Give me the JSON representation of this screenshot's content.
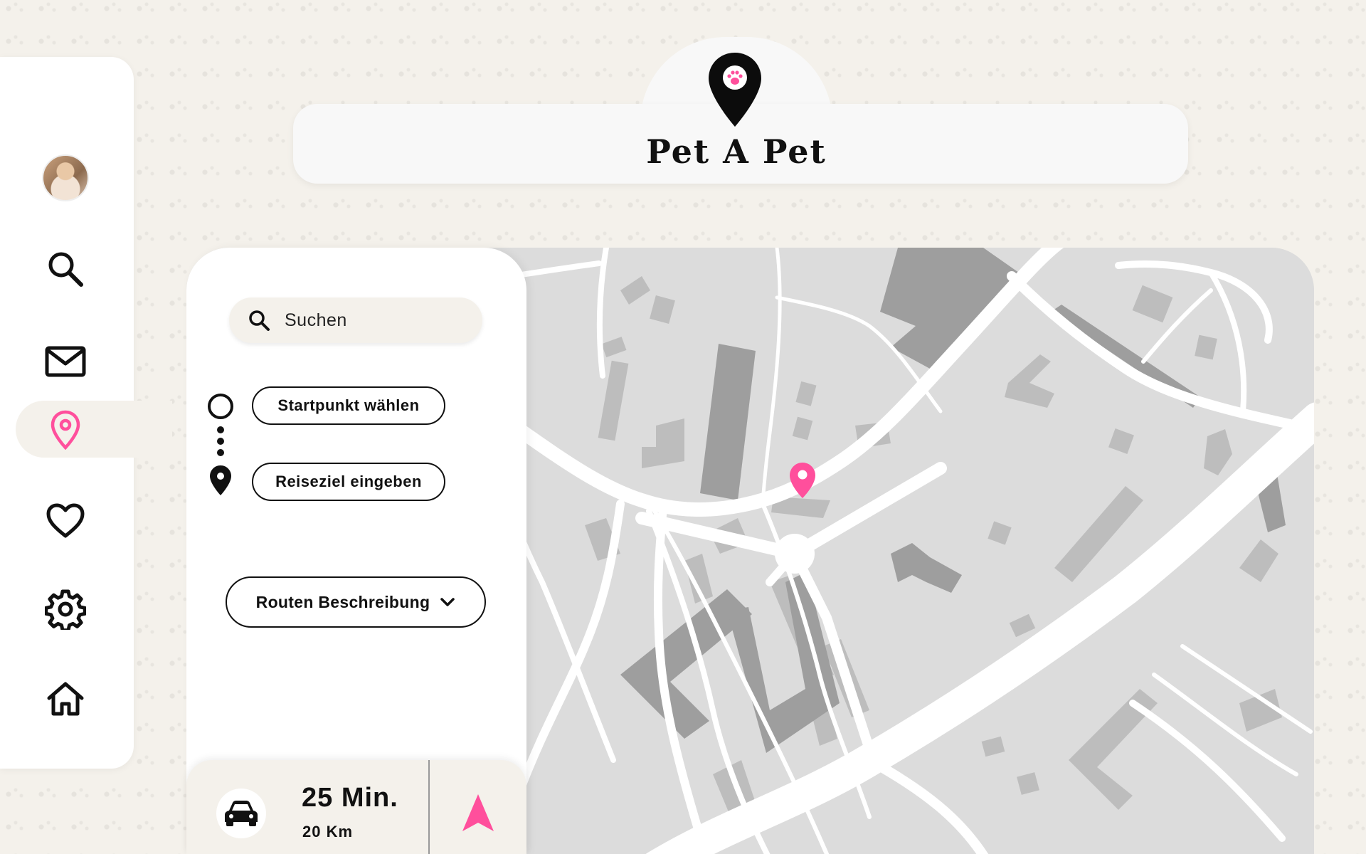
{
  "app": {
    "title": "Pet A Pet",
    "accent": "#ff4f9c"
  },
  "sidebar": {
    "items": [
      {
        "icon": "avatar"
      },
      {
        "icon": "search-icon"
      },
      {
        "icon": "mail-icon"
      },
      {
        "icon": "map-pin-icon",
        "active": true
      },
      {
        "icon": "heart-icon"
      },
      {
        "icon": "gear-icon"
      },
      {
        "icon": "home-icon"
      }
    ]
  },
  "route": {
    "search_placeholder": "Suchen",
    "start_label": "Startpunkt wählen",
    "destination_label": "Reiseziel eingeben",
    "description_label": "Routen Beschreibung"
  },
  "trip": {
    "duration": "25 Min.",
    "distance": "20 Km",
    "mode_icon": "car-icon"
  }
}
